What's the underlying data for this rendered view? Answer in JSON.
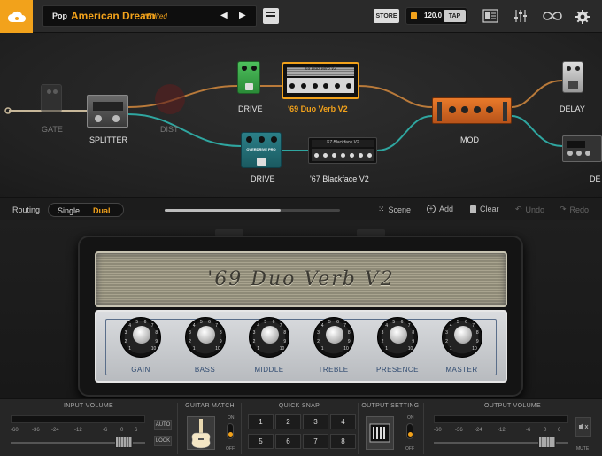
{
  "topbar": {
    "bank": "Pop",
    "preset_name": "American Dream",
    "edited": "*Edited",
    "prev_arrow": "◀",
    "next_arrow": "▶",
    "store_label": "STORE",
    "tempo": "120.0",
    "tap_label": "TAP"
  },
  "accent_color": "#f2a21b",
  "chain": {
    "gate": "GATE",
    "splitter": "SPLITTER",
    "dist": "DIST",
    "drive_top": "DRIVE",
    "amp_top": "'69 Duo Verb V2",
    "drive_bottom": "DRIVE",
    "amp_bottom": "'67 Blackface V2",
    "mod": "MOD",
    "delay": "DELAY",
    "cut_label": "DE",
    "pedal_bottom_text": "OVERDRIVE PRO",
    "amp_top_plate": "'69 Duo Verb V2",
    "amp_bottom_plate": "'67 Blackface V2"
  },
  "routing": {
    "label": "Routing",
    "single": "Single",
    "dual": "Dual",
    "slider_fraction": 0.66,
    "scene": "Scene",
    "add": "Add",
    "clear": "Clear",
    "undo": "Undo",
    "redo": "Redo"
  },
  "amp": {
    "name": "'69 Duo Verb V2",
    "knobs": [
      {
        "label": "GAIN"
      },
      {
        "label": "BASS"
      },
      {
        "label": "MIDDLE"
      },
      {
        "label": "TREBLE"
      },
      {
        "label": "PRESENCE"
      },
      {
        "label": "MASTER"
      }
    ]
  },
  "bottom": {
    "input_title": "INPUT VOLUME",
    "input_scale": [
      "-60",
      "-36",
      "-24",
      "-12",
      "-6",
      "0",
      "6"
    ],
    "auto": "AUTO",
    "lock": "LOCK",
    "guitar_title": "GUITAR MATCH",
    "on": "ON",
    "off": "OFF",
    "snap_title": "QUICK SNAP",
    "snaps": [
      "1",
      "2",
      "3",
      "4",
      "5",
      "6",
      "7",
      "8"
    ],
    "output_setting_title": "OUTPUT SETTING",
    "output_title": "OUTPUT VOLUME",
    "output_scale": [
      "-60",
      "-36",
      "-24",
      "-12",
      "-6",
      "0",
      "6"
    ],
    "mute": "MUTE"
  }
}
